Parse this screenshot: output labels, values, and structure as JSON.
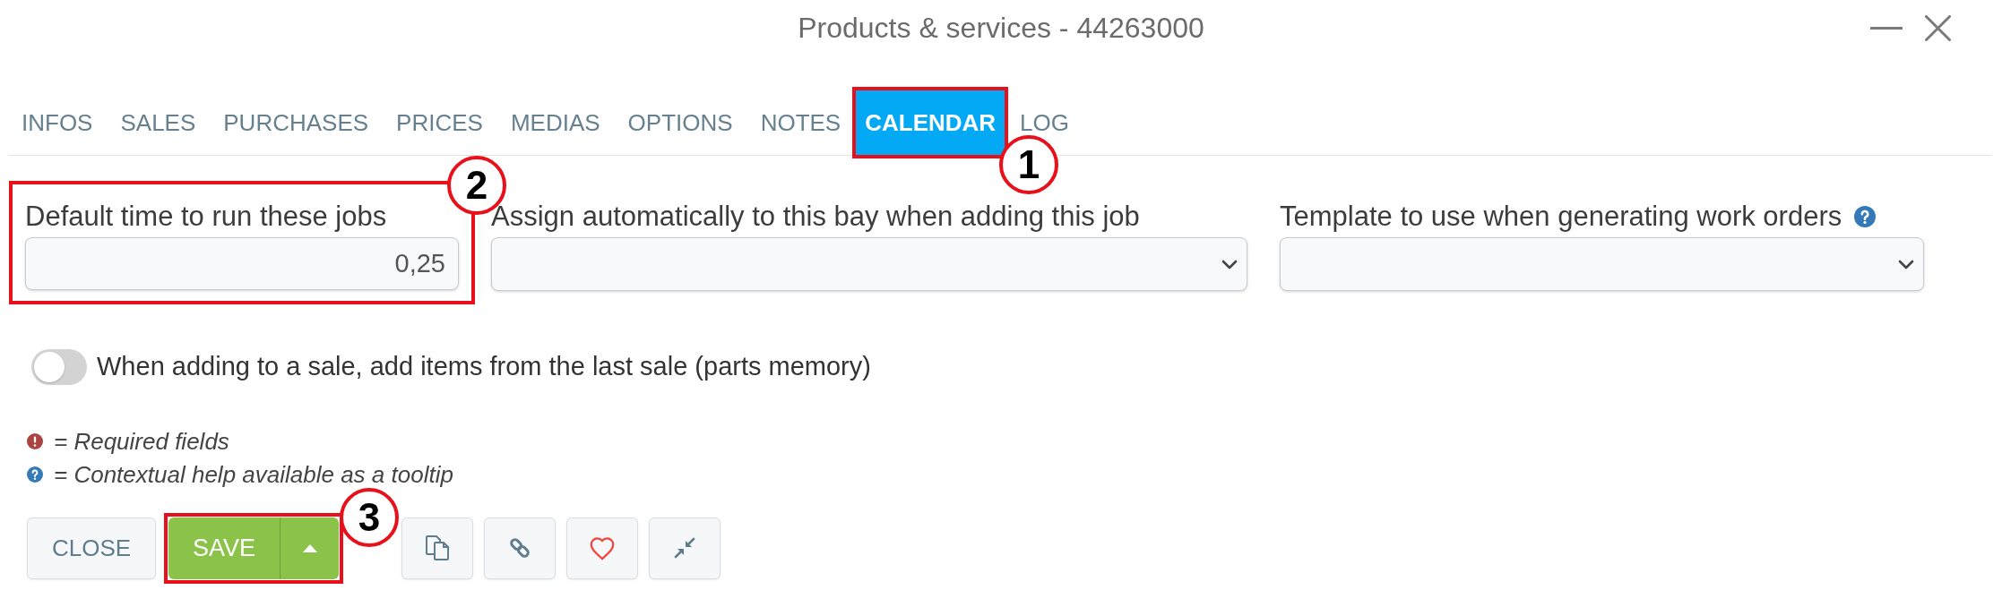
{
  "window": {
    "title": "Products & services - 44263000"
  },
  "tabs": [
    {
      "label": "INFOS",
      "selected": false
    },
    {
      "label": "SALES",
      "selected": false
    },
    {
      "label": "PURCHASES",
      "selected": false
    },
    {
      "label": "PRICES",
      "selected": false
    },
    {
      "label": "MEDIAS",
      "selected": false
    },
    {
      "label": "OPTIONS",
      "selected": false
    },
    {
      "label": "NOTES",
      "selected": false
    },
    {
      "label": "CALENDAR",
      "selected": true,
      "callout": "1"
    },
    {
      "label": "LOG",
      "selected": false
    }
  ],
  "fields": [
    {
      "kind": "number",
      "label": "Default time to run these jobs",
      "value": "0,25",
      "help": false,
      "callout": "2"
    },
    {
      "kind": "select",
      "label": "Assign automatically to this bay when adding this job",
      "help": false
    },
    {
      "kind": "select",
      "label": "Template to use when generating work orders",
      "help": true
    }
  ],
  "toggle": {
    "label": "When adding to a sale, add items from the last sale (parts memory)",
    "on": false
  },
  "legend": [
    {
      "kind": "required",
      "text": "= Required fields"
    },
    {
      "kind": "help",
      "text": "= Contextual help available as a tooltip"
    }
  ],
  "buttons": [
    {
      "kind": "close",
      "label": "CLOSE"
    },
    {
      "kind": "save",
      "label": "SAVE",
      "callout": "3"
    },
    {
      "kind": "duplicate"
    },
    {
      "kind": "link"
    },
    {
      "kind": "favorite"
    },
    {
      "kind": "compact"
    }
  ]
}
